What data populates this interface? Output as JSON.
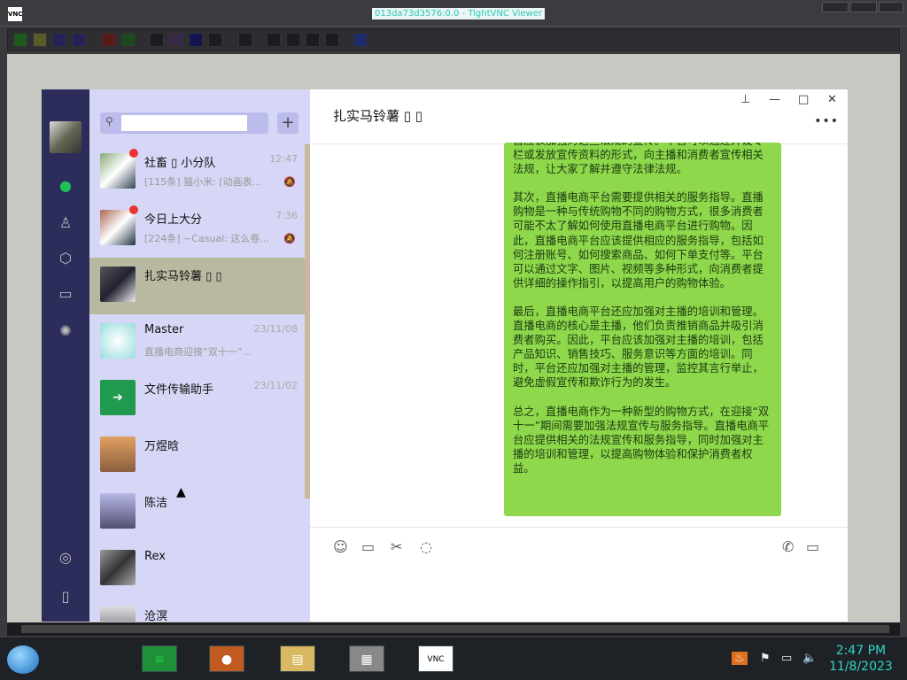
{
  "vnc": {
    "title": "013da73d3576:0.0 - TightVNC Viewer",
    "logo": "VNC"
  },
  "wechat": {
    "search": {
      "placeholder": ""
    },
    "add_label": "+",
    "nav": [
      "chat-icon",
      "contacts-icon",
      "box-icon",
      "folder-icon",
      "moments-icon",
      "mini-program-icon",
      "phone-icon"
    ],
    "chats": [
      {
        "name": "社畜 ▯ 小分队",
        "preview": "[115条] 猫小米: [动画表...",
        "time": "12:47",
        "unread": true,
        "muted": true
      },
      {
        "name": "今日上大分",
        "preview": "[224条] ~Casual: 这么卷...",
        "time": "7:36",
        "unread": true,
        "muted": true
      },
      {
        "name": "扎实马铃薯 ▯ ▯",
        "preview": "",
        "time": "",
        "unread": false,
        "muted": false
      },
      {
        "name": "Master",
        "preview": "直播电商迎接“双十一”...",
        "time": "23/11/08",
        "unread": false,
        "muted": false
      },
      {
        "name": "文件传输助手",
        "preview": "",
        "time": "23/11/02",
        "unread": false,
        "muted": false
      },
      {
        "name": "万煜晗",
        "preview": "",
        "time": "",
        "unread": false,
        "muted": false
      },
      {
        "name": "陈洁",
        "preview": "",
        "time": "",
        "unread": false,
        "muted": false
      },
      {
        "name": "Rex",
        "preview": "",
        "time": "",
        "unread": false,
        "muted": false
      },
      {
        "name": "沧溟",
        "preview": "",
        "time": "",
        "unread": false,
        "muted": false
      }
    ],
    "chat_title": "扎实马铃薯 ▯ ▯",
    "message": [
      "首应该加强对这些法规的宣传。平台可以通过开设专栏或发放宣传资料的形式，向主播和消费者宣传相关法规，让大家了解并遵守法律法规。",
      "其次，直播电商平台需要提供相关的服务指导。直播购物是一种与传统购物不同的购物方式，很多消费者可能不太了解如何使用直播电商平台进行购物。因此，直播电商平台应该提供相应的服务指导，包括如何注册账号、如何搜索商品、如何下单支付等。平台可以通过文字、图片、视频等多种形式，向消费者提供详细的操作指引，以提高用户的购物体验。",
      "最后，直播电商平台还应加强对主播的培训和管理。直播电商的核心是主播，他们负责推销商品并吸引消费者购买。因此，平台应该加强对主播的培训，包括产品知识、销售技巧、服务意识等方面的培训。同时，平台还应加强对主播的管理，监控其言行举止，避免虚假宣传和欺诈行为的发生。",
      "总之，直播电商作为一种新型的购物方式，在迎接“双十一”期间需要加强法规宣传与服务指导。直播电商平台应提供相关的法规宣传和服务指导，同时加强对主播的培训和管理，以提高购物体验和保护消费者权益。"
    ],
    "bubble_color": "#8fd84c"
  },
  "taskbar": {
    "time": "2:47 PM",
    "date": "11/8/2023"
  }
}
